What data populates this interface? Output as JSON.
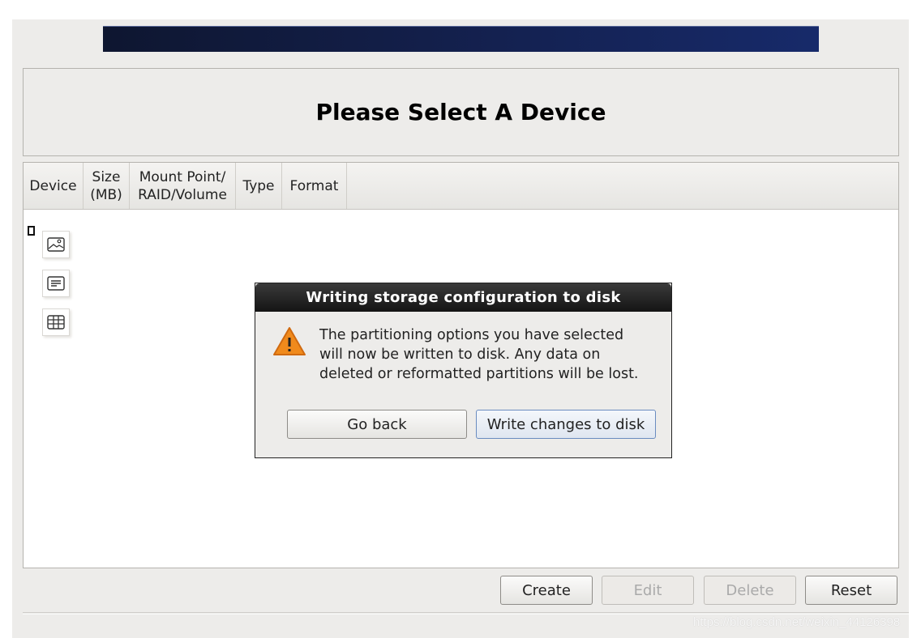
{
  "header": {
    "title": "Please Select A Device"
  },
  "table": {
    "columns": [
      "Device",
      "Size\n(MB)",
      "Mount Point/\nRAID/Volume",
      "Type",
      "Format"
    ]
  },
  "side_tools": [
    "image-icon",
    "text-icon",
    "table-icon"
  ],
  "dialog": {
    "title": "Writing storage configuration to disk",
    "icon": "warning-icon",
    "message": "The partitioning options you have selected\nwill now be written to disk.  Any data on\ndeleted or reformatted partitions will be lost.",
    "go_back": "Go back",
    "write": "Write changes to disk"
  },
  "actions": {
    "create": "Create",
    "edit": "Edit",
    "delete": "Delete",
    "reset": "Reset"
  },
  "watermark": "https://blog.csdn.net/weixin_44126398",
  "colors": {
    "banner": "#131f4a",
    "warning": "#f08a1c"
  }
}
